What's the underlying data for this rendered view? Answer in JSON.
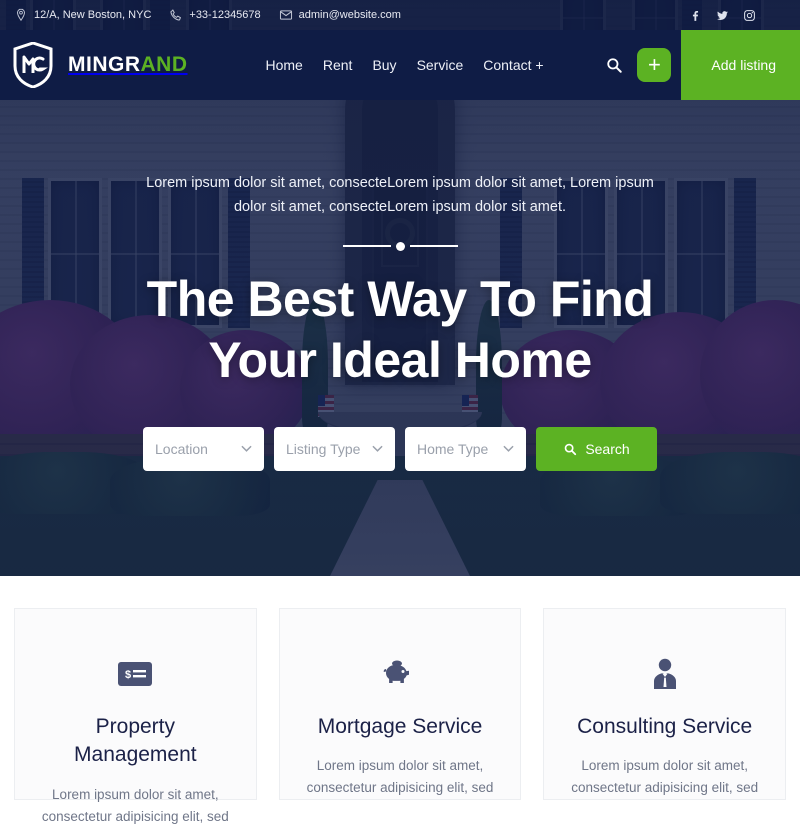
{
  "topbar": {
    "address": "12/A, New Boston, NYC",
    "phone": "+33-12345678",
    "email": "admin@website.com",
    "socials": [
      {
        "name": "facebook-icon",
        "label": "Facebook"
      },
      {
        "name": "twitter-icon",
        "label": "Twitter"
      },
      {
        "name": "instagram-icon",
        "label": "Instagram"
      }
    ]
  },
  "brand": {
    "name_first": "MINGR",
    "name_second": "AND",
    "logo_icon": "shield-monogram-icon"
  },
  "nav": {
    "items": [
      {
        "label": "Home"
      },
      {
        "label": "Rent"
      },
      {
        "label": "Buy"
      },
      {
        "label": "Service"
      },
      {
        "label": "Contact +"
      }
    ],
    "search_icon": "search-icon",
    "plus_label": "+",
    "add_listing_label": "Add listing"
  },
  "hero": {
    "subtitle": "Lorem ipsum dolor sit amet, consecteLorem ipsum dolor sit amet, Lorem ipsum dolor sit amet, consecteLorem ipsum dolor sit amet.",
    "title_line1": "The Best Way To Find",
    "title_line2": "Your Ideal Home",
    "search": {
      "location_placeholder": "Location",
      "listing_type_placeholder": "Listing Type",
      "home_type_placeholder": "Home Type",
      "button_label": "Search"
    }
  },
  "services": [
    {
      "icon": "money-check-icon",
      "title": "Property Management",
      "desc": "Lorem ipsum dolor sit amet, consectetur adipisicing elit, sed"
    },
    {
      "icon": "piggy-bank-icon",
      "title": "Mortgage Service",
      "desc": "Lorem ipsum dolor sit amet, consectetur adipisicing elit, sed"
    },
    {
      "icon": "business-person-icon",
      "title": "Consulting Service",
      "desc": "Lorem ipsum dolor sit amet, consectetur adipisicing elit, sed"
    }
  ],
  "colors": {
    "accent_green": "#5cb223",
    "navy": "#0f1c45",
    "heading": "#1b2147",
    "body_text": "#6f7688"
  }
}
